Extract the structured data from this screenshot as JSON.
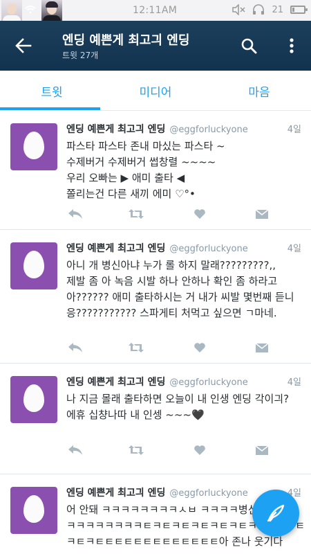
{
  "status_bar": {
    "time": "12:11AM",
    "battery_text": "21",
    "battery_level_pct": 21
  },
  "header": {
    "title": "엔딩 예쁜게 최고긔 엔딩",
    "subtitle": "트윗 27개",
    "icons": [
      "back-arrow-icon",
      "search-icon",
      "more-vertical-icon"
    ]
  },
  "tabs": [
    {
      "label": "트윗",
      "active": true
    },
    {
      "label": "미디어",
      "active": false
    },
    {
      "label": "마음",
      "active": false
    }
  ],
  "tweets": [
    {
      "name": "엔딩 예쁜게 최고긔 엔딩",
      "handle": "@eggforluckyone",
      "time": "4일",
      "text": "파스타 파스타 존내 마싰는 파스타 ~\n수제버거 수제버거 썹창렬 ~~~~\n우리 오빠는 ▶ 애미 출타 ◀\n쫄리는건 다른 새끼 에미 ♡°•"
    },
    {
      "name": "엔딩 예쁜게 최고긔 엔딩",
      "handle": "@eggforluckyone",
      "time": "4일",
      "text": "아니 개 병신아냐 누가 롤 하지 말래?????????,,\n제발 좀 아 녹음 시발 하나 안하나 확인 좀 하라고 아?????? 애미 출타하시는 거 내가 씨발 몇번째 듣니 응??????????? 스파게티 처먹고 싶으면 ㄱ마네."
    },
    {
      "name": "엔딩 예쁜게 최고긔 엔딩",
      "handle": "@eggforluckyone",
      "time": "4일",
      "text": "나 지금 몰래 출타하면 오늘이 내 인생 엔딩 각이긔?\n에휴 십챵나따 내 인셍 ~~~🖤"
    },
    {
      "name": "엔딩 예쁜게 최고긔 엔딩",
      "handle": "@eggforluckyone",
      "time": "4일",
      "text": "어 안돼 ㅋㅋㅋㅋㅋㅋㅋㅋㅅㅂ ㅋㅋㅋㅋ병신새끼 저거\nㅋㅋㅋㅋㅋㅋㅋㅋㅌㅋㅌㅋㅌㅋㅌㅋㅌㅋㅌㅋㅌㅋㅌㅋㅌㅋㅌㅋㅌㅌㅌㅌㅌㅌㅌㅌㅌㅌㅌㅌㅌ아 존나 웃기다"
    }
  ],
  "action_icons": [
    "reply-icon",
    "retweet-icon",
    "like-icon",
    "message-icon"
  ],
  "colors": {
    "header_bg": "#17395a",
    "accent": "#1da1f2",
    "avatar_bg": "#8b4fb0",
    "secondary_text": "#8899a6"
  }
}
